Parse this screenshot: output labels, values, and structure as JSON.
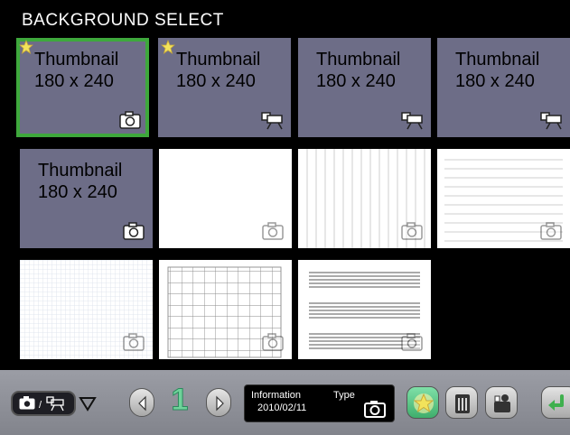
{
  "title": "BACKGROUND SELECT",
  "tiles": [
    {
      "label": "Thumbnail\n180 x 240",
      "kind": "thumb",
      "starred": true,
      "selected": true,
      "type": "camera-icon"
    },
    {
      "label": "Thumbnail\n180 x 240",
      "kind": "thumb",
      "starred": true,
      "selected": false,
      "type": "projector-icon"
    },
    {
      "label": "Thumbnail\n180 x 240",
      "kind": "thumb",
      "starred": false,
      "selected": false,
      "type": "projector-icon"
    },
    {
      "label": "Thumbnail\n180 x 240",
      "kind": "thumb",
      "starred": false,
      "selected": false,
      "type": "projector-icon"
    },
    {
      "label": "Thumbnail\n180 x 240",
      "kind": "thumb",
      "starred": false,
      "selected": false,
      "type": "camera-icon"
    },
    {
      "label": "",
      "kind": "blank",
      "type": "camera-icon"
    },
    {
      "label": "",
      "kind": "vertical-lines",
      "type": "camera-icon"
    },
    {
      "label": "",
      "kind": "horizontal-lines",
      "type": "camera-icon"
    },
    {
      "label": "",
      "kind": "fine-grid",
      "type": "camera-icon"
    },
    {
      "label": "",
      "kind": "large-grid",
      "type": "camera-icon"
    },
    {
      "label": "",
      "kind": "staff-lines",
      "type": "camera-icon"
    }
  ],
  "toolbar": {
    "mode_icons": [
      "camera-icon",
      "projector-icon"
    ],
    "mode_separator": "/",
    "dropdown_icon": "triangle-down-icon",
    "prev_icon": "chevron-left-icon",
    "page_number": "1",
    "next_icon": "chevron-right-icon",
    "info_label": "Information",
    "info_date": "2010/02/11",
    "type_label": "Type",
    "type_icon": "camera-icon",
    "favorite_icon": "star-icon",
    "delete_icon": "trash-icon",
    "user_icon": "user-icon",
    "return_icon": "return-icon"
  },
  "colors": {
    "thumb_bg": "#6d6d87",
    "selected_border": "#3ea83c",
    "star": "#f2e35b",
    "page_number": "#6fd29a",
    "favorite_btn": "#57c78a",
    "return_btn": "#5fcf6b"
  }
}
